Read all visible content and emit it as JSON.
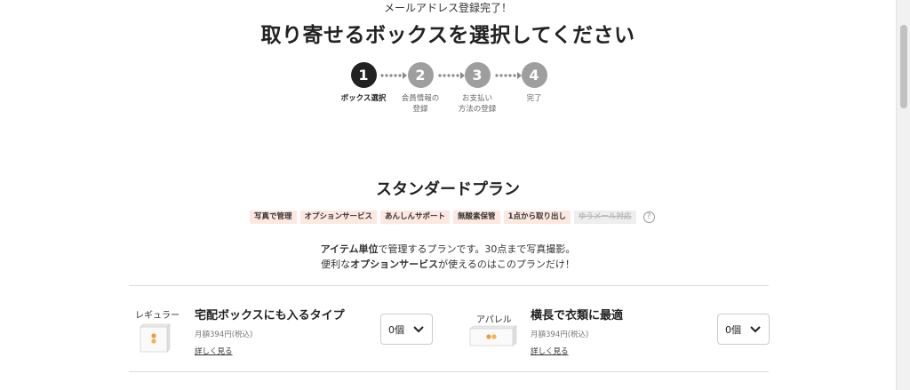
{
  "header": {
    "subtitle": "メールアドレス登録完了！",
    "title": "取り寄せるボックスを選択してください"
  },
  "steps": [
    {
      "number": "1",
      "label": "ボックス選択",
      "active": true
    },
    {
      "number": "2",
      "label": "会員情報の\n登録",
      "active": false
    },
    {
      "number": "3",
      "label": "お支払い\n方法の登録",
      "active": false
    },
    {
      "number": "4",
      "label": "完了",
      "active": false
    }
  ],
  "plan": {
    "title": "スタンダードプラン",
    "tags": [
      {
        "label": "写真で管理",
        "disabled": false
      },
      {
        "label": "オプションサービス",
        "disabled": false
      },
      {
        "label": "あんしんサポート",
        "disabled": false
      },
      {
        "label": "無酸素保管",
        "disabled": false
      },
      {
        "label": "1点から取り出し",
        "disabled": false
      },
      {
        "label": "ゆうメール対応",
        "disabled": true
      }
    ],
    "help_icon": "?",
    "description": {
      "line1_bold": "アイテム単位",
      "line1_rest": "で管理するプランです。30点まで写真撮影。",
      "line2_pre": "便利な",
      "line2_bold": "オプションサービス",
      "line2_rest": "が使えるのはこのプランだけ！"
    }
  },
  "items": [
    {
      "type_label": "レギュラー",
      "title": "宅配ボックスにも入るタイプ",
      "price": "月額394円(税込)",
      "link": "詳しく見る",
      "quantity": "0個"
    },
    {
      "type_label": "アパレル",
      "title": "横長で衣類に最適",
      "price": "月額394円(税込)",
      "link": "詳しく見る",
      "quantity": "0個"
    }
  ],
  "colors": {
    "step_active": "#222222",
    "step_inactive": "#9e9e9e",
    "tag_bg": "#fde8e1",
    "box_accent": "#f39a3c"
  }
}
